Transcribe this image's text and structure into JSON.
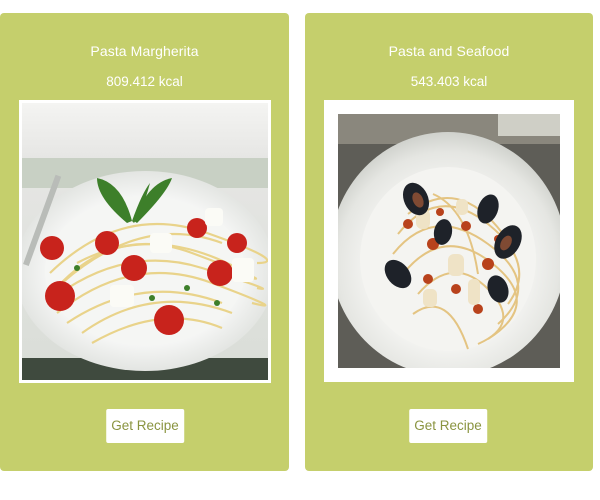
{
  "recipes": [
    {
      "title": "Pasta Margherita",
      "kcal": "809.412 kcal",
      "button_label": "Get Recipe",
      "image": "pasta-margherita-photo"
    },
    {
      "title": "Pasta and Seafood",
      "kcal": "543.403 kcal",
      "button_label": "Get Recipe",
      "image": "pasta-seafood-photo"
    }
  ],
  "colors": {
    "card_background": "#c5cf6c",
    "text": "#ffffff",
    "button_text": "#8a9440"
  }
}
